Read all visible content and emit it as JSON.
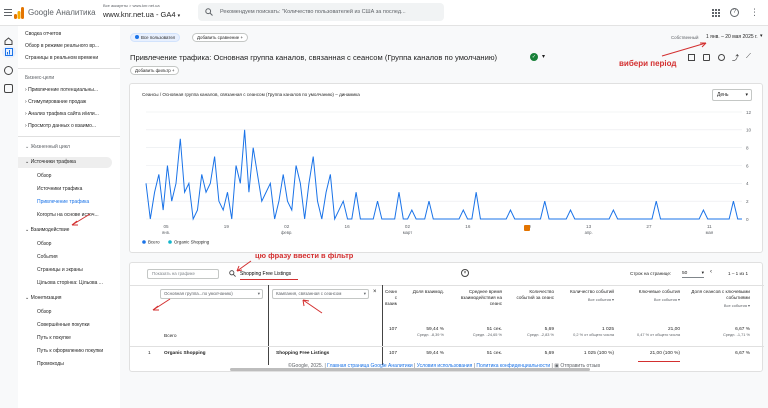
{
  "topbar": {
    "brand": "Google Аналитика",
    "account_crumb": "Все аккаунты > www.knr.net.ua",
    "property": "www.knr.net.ua - GA4",
    "search_placeholder": "Рекомендуем поискать: \"Количество пользователей из США за послед..."
  },
  "nav": {
    "top_items": [
      "Сводка отчетов",
      "Обзор в режиме реального вр...",
      "Страницы в реальном времени"
    ],
    "section1": "Бизнес-цели",
    "biz_items": [
      "Привлечение потенциальны...",
      "Стимулирование продаж",
      "Анализ трафика сайта и/или...",
      "Просмотр данных о взаимо..."
    ],
    "section2": "Жизненный цикл",
    "lifecycle": "Источники трафика",
    "lifecycle_items": [
      "Обзор",
      "Источники трафика",
      "Привлечение трафика",
      "Когорты на основе источ..."
    ],
    "engagement": "Взаимодействие",
    "engagement_items": [
      "Обзор",
      "События",
      "Страницы и экраны",
      "Цільова сторінка: Цільова ..."
    ],
    "monetization": "Монетизация",
    "monetization_items": [
      "Обзор",
      "Совершённые покупки",
      "Путь к покупке",
      "Путь к оформлению покупки",
      "Промокоды"
    ]
  },
  "filters": {
    "all_users": "Все пользовател",
    "add_comparison": "Добавить сравнение +",
    "custom": "Собственный",
    "date_range": "1 янв. – 20 мая 2025 г."
  },
  "report": {
    "title": "Привлечение трафика: Основная группа каналов, связанная с сеансом (Группа каналов по умолчанию)",
    "add_filter": "Добавить фильтр +"
  },
  "annotations": {
    "choose_period": "вибери період",
    "enter_filter": "цю фразу ввести в фільтр"
  },
  "chart_data": {
    "type": "line",
    "title": "Сеансы / Основная группа каналов, связанная с сеансом (Группа каналов по умолчанию) – динамика",
    "granularity": "День",
    "x_ticks": [
      {
        "day": "05",
        "month": "янв."
      },
      {
        "day": "19",
        "month": ""
      },
      {
        "day": "02",
        "month": "февр."
      },
      {
        "day": "16",
        "month": ""
      },
      {
        "day": "02",
        "month": "март"
      },
      {
        "day": "16",
        "month": ""
      },
      {
        "day": "30",
        "month": ""
      },
      {
        "day": "13",
        "month": "апр."
      },
      {
        "day": "27",
        "month": ""
      },
      {
        "day": "11",
        "month": "мая"
      }
    ],
    "y_ticks": [
      "0",
      "2",
      "4",
      "6",
      "8",
      "10",
      "12"
    ],
    "ylim": [
      0,
      12
    ],
    "legend": [
      "Всего",
      "Organic Shopping"
    ],
    "series_values": [
      4,
      0,
      3,
      5,
      1,
      6,
      2,
      4,
      9,
      3,
      4,
      0,
      1,
      5,
      3,
      4,
      7,
      2,
      1,
      3,
      0,
      6,
      4,
      10,
      3,
      8,
      5,
      2,
      3,
      4,
      0,
      2,
      5,
      2,
      1,
      6,
      4,
      0,
      4,
      7,
      2,
      0,
      3,
      5,
      0,
      1,
      2,
      0,
      0,
      3,
      0,
      0,
      0,
      0,
      2,
      0,
      0,
      0,
      0,
      3,
      0,
      0,
      1,
      0,
      0,
      0,
      2,
      0,
      0,
      0,
      0,
      0,
      0,
      0,
      1,
      0,
      0,
      3,
      0,
      0,
      0,
      0,
      0,
      0,
      0,
      1,
      0,
      0,
      0,
      0,
      0,
      0,
      0,
      2,
      0,
      0,
      0,
      0,
      0,
      1,
      0,
      0,
      0,
      0,
      0,
      0,
      0,
      0,
      0,
      1,
      0,
      0,
      0,
      0,
      0,
      0,
      0,
      0,
      0,
      2,
      0,
      0,
      0,
      0,
      0,
      0,
      0,
      0,
      0,
      0,
      1,
      0,
      0,
      0,
      0,
      0,
      0,
      2,
      0,
      0
    ]
  },
  "table": {
    "search_placeholder": "Поиск",
    "search_value": "Shopping Free Listings",
    "rows_per_page_label": "Строк на странице:",
    "rows_per_page": "50",
    "pagination": "1 – 1 из 1",
    "dim1": "Основная группа...по умолчанию)",
    "dim2": "Кампания, связанная с сеансом",
    "columns": [
      {
        "label": "Сеансы с взаимод.",
        "sub": ""
      },
      {
        "label": "Доля взаимод.",
        "sub": ""
      },
      {
        "label": "Среднее время взаимодействия на сеанс",
        "sub": ""
      },
      {
        "label": "Количество событий за сеанс",
        "sub": ""
      },
      {
        "label": "Количество событий",
        "sub": "Все события"
      },
      {
        "label": "Ключевые события",
        "sub": "Все события"
      },
      {
        "label": "Доля сеансов с ключевыми событиями",
        "sub": "Все события"
      }
    ],
    "total_label": "Всего",
    "totals": [
      "107",
      "59,44 %",
      "51 сек.",
      "5,69",
      "1 025",
      "21,00",
      "6,67 %"
    ],
    "totals_sub": [
      "",
      "Средн. -8,39 %",
      "Средн. -24,65 %",
      "Средн. -2,83 %",
      "0,2 % от общего числа",
      "0,47 % от общего числа",
      "Средн. -1,71 %"
    ],
    "rows": [
      {
        "index": "1",
        "channel": "Organic Shopping",
        "campaign": "Shopping Free Listings",
        "values": [
          "107",
          "59,44 %",
          "51 сек.",
          "5,69",
          "1 025 (100 %)",
          "21,00 (100 %)",
          "6,67 %"
        ]
      }
    ]
  },
  "footer": {
    "copyright": "©Google, 2025. |",
    "links": [
      "Главная страница Google Аналитики",
      "Условия использования",
      "Политика конфиденциальности"
    ],
    "feedback": "Отправить отзыв"
  }
}
